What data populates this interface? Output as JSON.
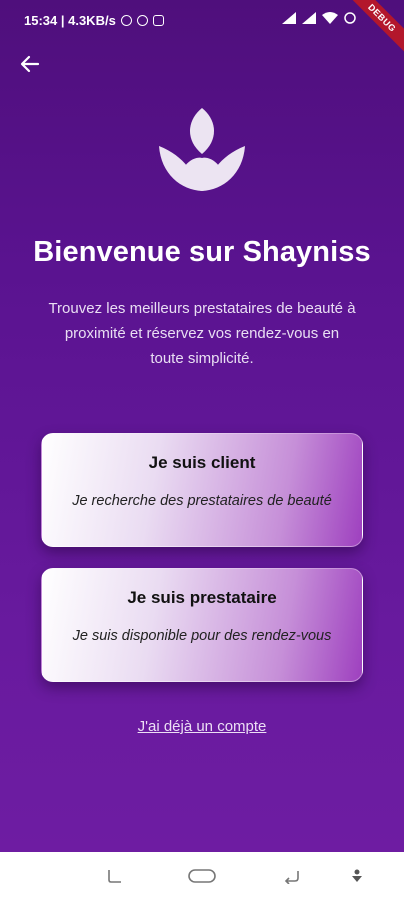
{
  "status_bar": {
    "time_speed": "15:34 | 4.3KB/s",
    "debug_banner": "DEBUG"
  },
  "header": {
    "back_icon": "arrow-left-icon"
  },
  "logo": {
    "icon": "lotus-flower-icon"
  },
  "title": "Bienvenue sur Shayniss",
  "subtitle": "Trouvez les meilleurs prestataires de beauté à proximité et réservez vos rendez-vous en toute simplicité.",
  "cards": [
    {
      "title": "Je suis client",
      "description": "Je recherche des prestataires de beauté"
    },
    {
      "title": "Je suis prestataire",
      "description": "Je suis disponible pour des rendez-vous"
    }
  ],
  "login_link": "J'ai déjà un compte",
  "nav_bar": {
    "icons": [
      "recent-apps-icon",
      "home-icon",
      "back-icon",
      "hide-navbar-icon"
    ]
  },
  "colors": {
    "background_top": "#4f0f7c",
    "background_bottom": "#6f1da3",
    "card_accent": "#9e40bf",
    "debug_ribbon": "#b3172c"
  }
}
